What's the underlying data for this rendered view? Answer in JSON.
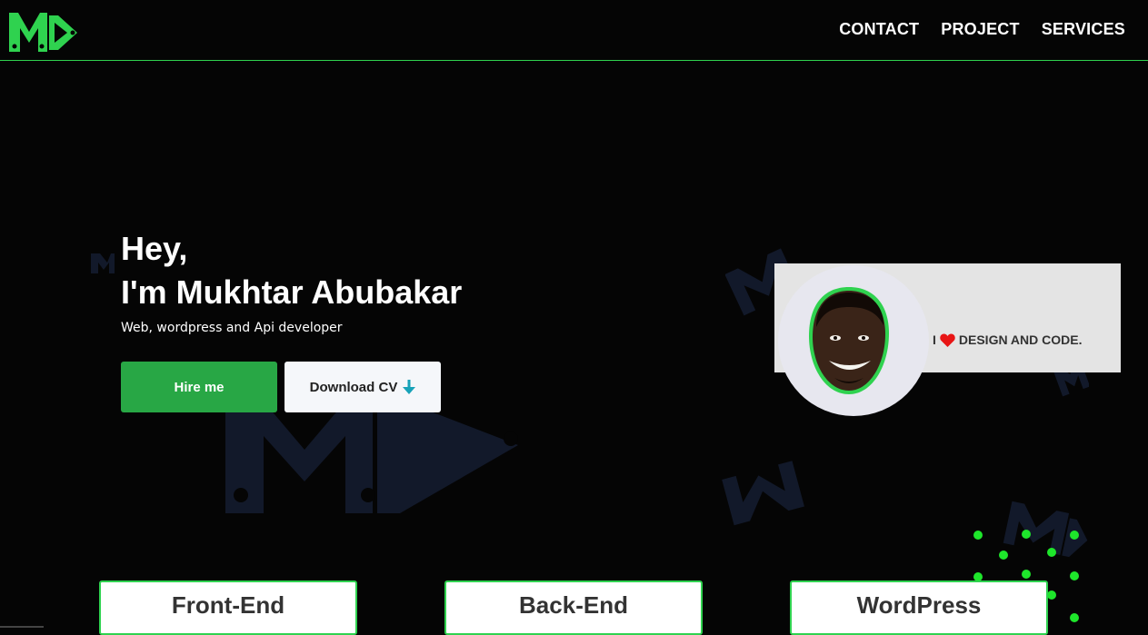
{
  "brand": {
    "logo_name": "MD",
    "accent": "#2fd24f"
  },
  "nav": {
    "items": [
      "CONTACT",
      "PROJECT",
      "SERVICES"
    ]
  },
  "hero": {
    "greeting": "Hey,",
    "name_line": "I'm Mukhtar Abubakar",
    "subtitle": "Web, wordpress and Api developer",
    "hire_label": "Hire me",
    "cv_label": "Download CV",
    "hire_color": "#28a745"
  },
  "profile": {
    "tagline_prefix": "I",
    "tagline_suffix": "DESIGN AND CODE.",
    "heart_icon": "heart-icon"
  },
  "services": {
    "items": [
      "Front-End",
      "Back-End",
      "WordPress"
    ]
  }
}
